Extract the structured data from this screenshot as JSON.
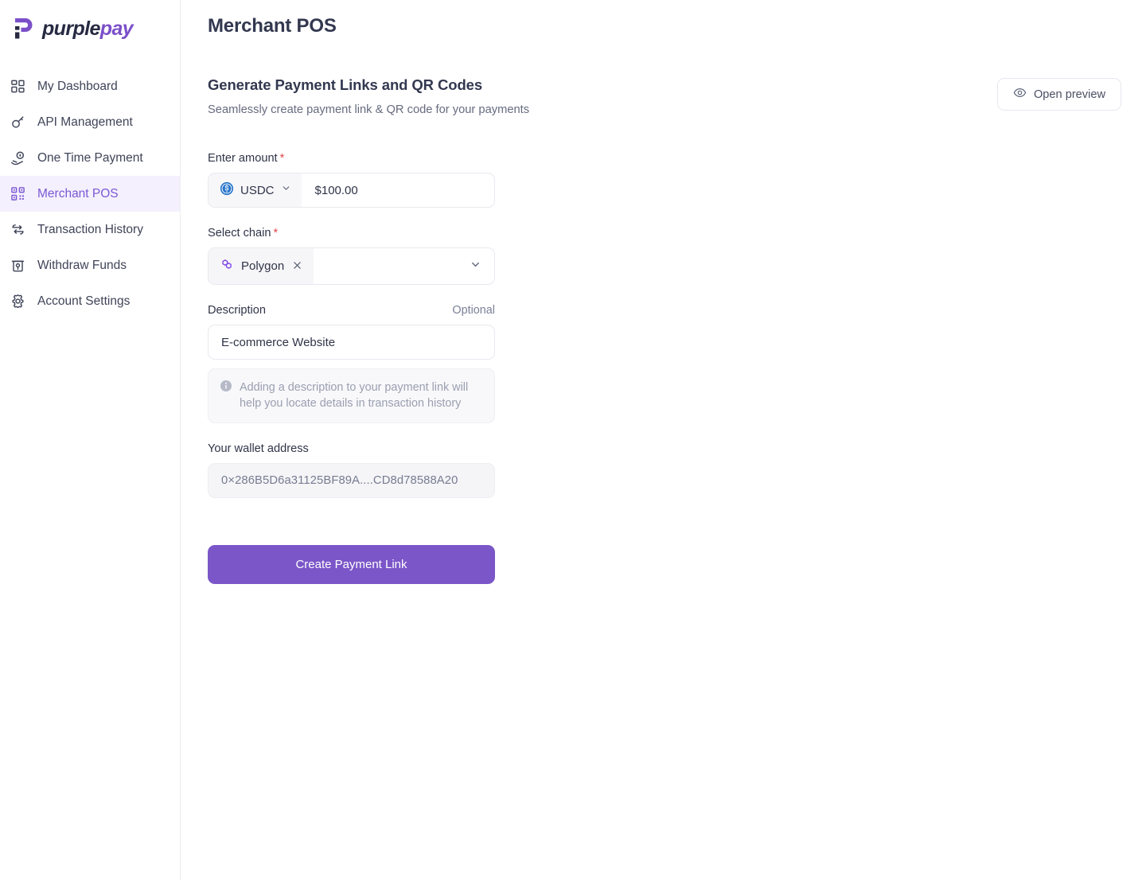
{
  "brand": {
    "name_part1": "purple",
    "name_part2": "pay",
    "logo_icon": "purplepay-p-mark",
    "accent_color": "#7b4fc9"
  },
  "sidebar": {
    "items": [
      {
        "label": "My Dashboard",
        "icon": "dashboard-grid-icon",
        "active": false
      },
      {
        "label": "API Management",
        "icon": "key-icon",
        "active": false
      },
      {
        "label": "One Time Payment",
        "icon": "hand-coin-icon",
        "active": false
      },
      {
        "label": "Merchant POS",
        "icon": "qr-code-icon",
        "active": true
      },
      {
        "label": "Transaction History",
        "icon": "swap-arrows-icon",
        "active": false
      },
      {
        "label": "Withdraw Funds",
        "icon": "atm-machine-icon",
        "active": false
      },
      {
        "label": "Account Settings",
        "icon": "gear-icon",
        "active": false
      }
    ],
    "active_bg_color": "#f4f0fd",
    "active_text_color": "#7b58d4"
  },
  "header": {
    "page_title": "Merchant POS"
  },
  "section": {
    "title": "Generate Payment Links and QR Codes",
    "subtitle": "Seamlessly create payment link & QR code for your payments",
    "preview_button": {
      "label": "Open preview",
      "icon": "eye-icon"
    }
  },
  "form": {
    "amount": {
      "label": "Enter amount",
      "required_marker": "*",
      "currency": "USDC",
      "currency_icon": "usdc-coin-icon",
      "currency_chevron_icon": "chevron-down-icon",
      "value": "$100.00"
    },
    "chain": {
      "label": "Select chain",
      "required_marker": "*",
      "selected": "Polygon",
      "chain_icon": "polygon-logo-icon",
      "remove_icon": "close-x-icon",
      "chevron_icon": "chevron-down-icon"
    },
    "description": {
      "label": "Description",
      "optional_label": "Optional",
      "value": "E-commerce Website",
      "hint_icon": "info-circle-icon",
      "hint": "Adding a description to your payment link will help you locate details in transaction history"
    },
    "wallet": {
      "label": "Your wallet address",
      "address": "0×286B5D6a31125BF89A....CD8d78588A20"
    },
    "submit": {
      "label": "Create Payment Link",
      "color": "#7b56c8"
    }
  }
}
